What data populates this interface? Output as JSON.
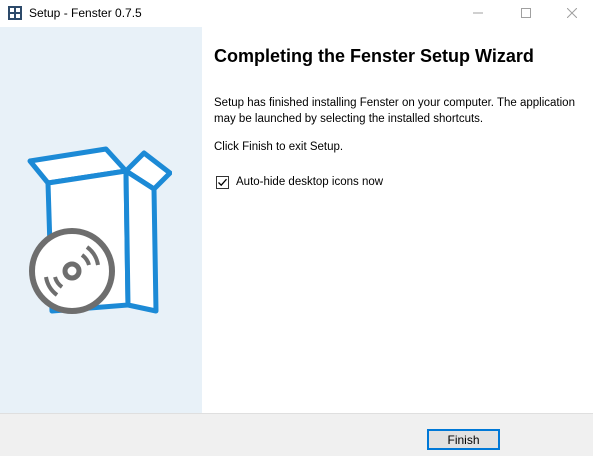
{
  "window": {
    "title": "Setup - Fenster 0.7.5",
    "app_icon": "installer-app-icon",
    "controls": [
      "minimize-icon",
      "maximize-icon",
      "close-icon"
    ]
  },
  "side_panel": {
    "illustration": "software-box-with-disc-icon",
    "colors": {
      "background": "#e8f1f8",
      "box": "#1c8ad6",
      "disc": "#6e6e6e"
    }
  },
  "content": {
    "heading": "Completing the Fenster Setup Wizard",
    "paragraph": "Setup has finished installing Fenster on your computer. The application may be launched by selecting the installed shortcuts.",
    "instruction": "Click Finish to exit Setup.",
    "checkbox": {
      "label": "Auto-hide desktop icons now",
      "checked": true
    }
  },
  "footer": {
    "finish_label": "Finish",
    "accent": "#0078d7"
  }
}
